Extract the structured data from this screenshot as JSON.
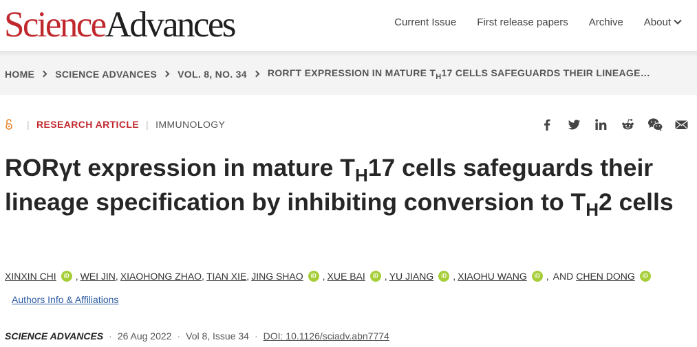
{
  "header": {
    "logo_part1": "Science",
    "logo_part2": "Advances",
    "nav": [
      "Current Issue",
      "First release papers",
      "Archive",
      "About"
    ]
  },
  "breadcrumb": [
    "HOME",
    "SCIENCE ADVANCES",
    "VOL. 8, NO. 34",
    "RORΓT EXPRESSION IN MATURE T",
    "H",
    "17 CELLS SAFEGUARDS THEIR LINEAGE…"
  ],
  "meta": {
    "access": "open-access-icon",
    "type": "RESEARCH ARTICLE",
    "subject": "IMMUNOLOGY"
  },
  "share_icons": [
    "facebook-icon",
    "twitter-icon",
    "linkedin-icon",
    "reddit-icon",
    "wechat-icon",
    "email-icon"
  ],
  "title": {
    "p1": "RORγt expression in mature T",
    "sub1": "H",
    "p2": "17 cells safeguards their lineage specification by inhibiting conversion to T",
    "sub2": "H",
    "p3": "2 cells"
  },
  "authors": {
    "list": [
      "XINXIN CHI",
      "WEI JIN",
      "XIAOHONG ZHAO",
      "TIAN XIE",
      "JING SHAO",
      "XUE BAI",
      "YU JIANG",
      "XIAOHU WANG",
      "CHEN DONG"
    ],
    "and_text": "AND",
    "affiliations_link": "Authors Info & Affiliations"
  },
  "journal": {
    "name": "SCIENCE ADVANCES",
    "date": "26 Aug 2022",
    "volume": "Vol 8, Issue 34",
    "doi": "DOI: 10.1126/sciadv.abn7774"
  },
  "colors": {
    "brand_red": "#c0282e",
    "orcid_green": "#a6ce39",
    "link_blue": "#2c5aa0"
  }
}
